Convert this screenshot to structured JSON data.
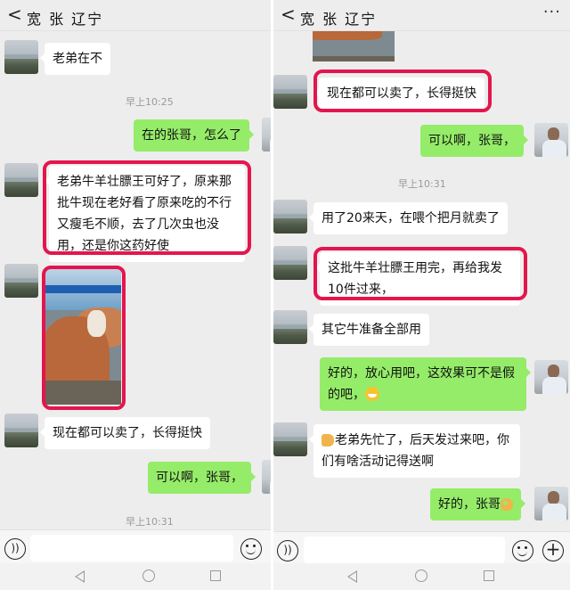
{
  "left": {
    "header": {
      "back": "<",
      "title": "宽 张 辽宁"
    },
    "messages": [
      {
        "text": "老弟在不"
      },
      {
        "time": "早上10:25"
      },
      {
        "text": "在的张哥，怎么了"
      },
      {
        "text": "老弟牛羊壮膘王可好了，原来那批牛现在老好看了原来吃的不行又瘦毛不顺，去了几次虫也没用，还是你这药好使"
      },
      {
        "text": "现在都可以卖了，长得挺快"
      },
      {
        "text": "可以啊，张哥，"
      },
      {
        "time": "早上10:31"
      }
    ]
  },
  "right": {
    "header": {
      "back": "<",
      "title": "宽 张 辽宁",
      "more": "···"
    },
    "messages": [
      {
        "text": "现在都可以卖了，长得挺快"
      },
      {
        "text": "可以啊，张哥，"
      },
      {
        "time": "早上10:31"
      },
      {
        "text": "用了20来天，在喂个把月就卖了"
      },
      {
        "text": "这批牛羊壮膘王用完，再给我发10件过来，"
      },
      {
        "text": "其它牛准备全部用"
      },
      {
        "text": "好的，放心用吧，这效果可不是假的吧，"
      },
      {
        "text": "老弟先忙了，后天发过来吧，你们有啥活动记得送啊"
      },
      {
        "text": "好的，张哥"
      }
    ]
  },
  "composer": {
    "voice": "))",
    "plus": "+"
  },
  "colors": {
    "outgoing_bubble": "#95ec69",
    "incoming_bubble": "#ffffff",
    "highlight": "#e4154e",
    "chat_bg": "#ededed"
  },
  "icons": [
    "back-icon",
    "more-icon",
    "voice-icon",
    "emoji-icon",
    "plus-icon",
    "nav-back-icon",
    "nav-home-icon",
    "nav-recent-icon"
  ]
}
